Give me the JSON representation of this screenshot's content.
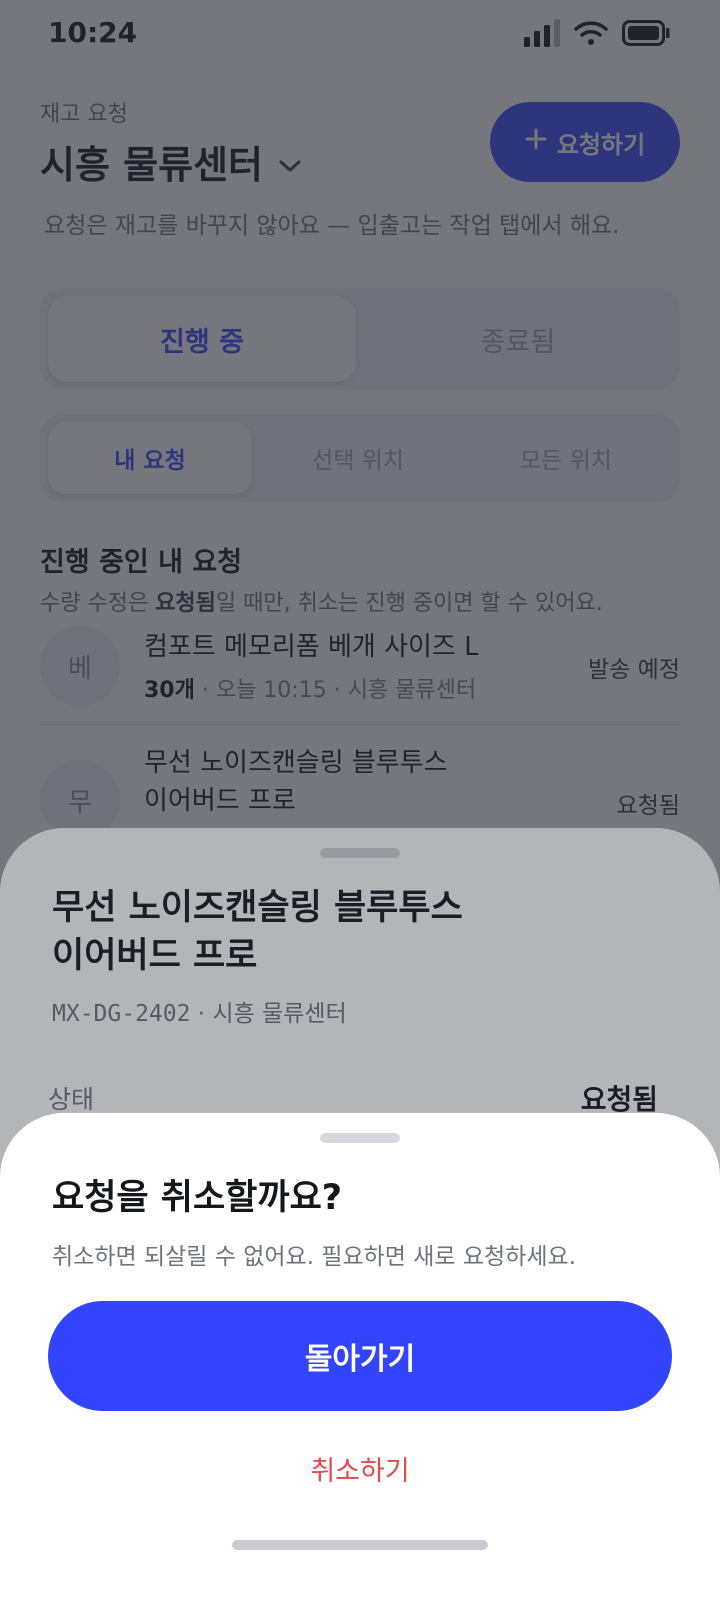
{
  "status_bar": {
    "time": "10:24"
  },
  "header": {
    "overline": "재고 요청",
    "title": "시흥 물류센터",
    "request_button": "요청하기",
    "note": "요청은 재고를 바꾸지 않아요 — 입출고는 작업 탭에서 해요."
  },
  "tabs_main": [
    {
      "label": "진행 중",
      "active": true
    },
    {
      "label": "종료됨",
      "active": false
    }
  ],
  "tabs_scope": [
    {
      "label": "내 요청",
      "active": true
    },
    {
      "label": "선택 위치",
      "active": false
    },
    {
      "label": "모든 위치",
      "active": false
    }
  ],
  "section": {
    "title": "진행 중인 내 요청",
    "note_bold": "요청됨",
    "note_pre": "수량 수정은 ",
    "note_post": "일 때만, 취소는 진행 중이면 할 수 있어요."
  },
  "requests": [
    {
      "avatar": "베",
      "name": "컴포트 메모리폼 베개 사이즈 L",
      "qty": "30개",
      "meta": " · 오늘 10:15 · 시흥 물류센터",
      "status": "발송 예정"
    },
    {
      "avatar": "무",
      "name_line1": "무선 노이즈캔슬링 블루투스",
      "name_line2": "이어버드 프로",
      "status": "요청됨"
    }
  ],
  "detail": {
    "title_line1": "무선 노이즈캔슬링 블루투스",
    "title_line2": "이어버드 프로",
    "sku": "MX-DG-2402",
    "location": " · 시흥 물류센터",
    "status_label": "상태",
    "status_value": "요청됨"
  },
  "confirm": {
    "title": "요청을 취소할까요?",
    "body": "취소하면 되살릴 수 없어요. 필요하면 새로 요청하세요.",
    "primary": "돌아가기",
    "danger": "취소하기"
  },
  "colors": {
    "accent": "#3344ff",
    "danger": "#e5484d",
    "scrim": "rgba(40,44,54,0.45)"
  }
}
